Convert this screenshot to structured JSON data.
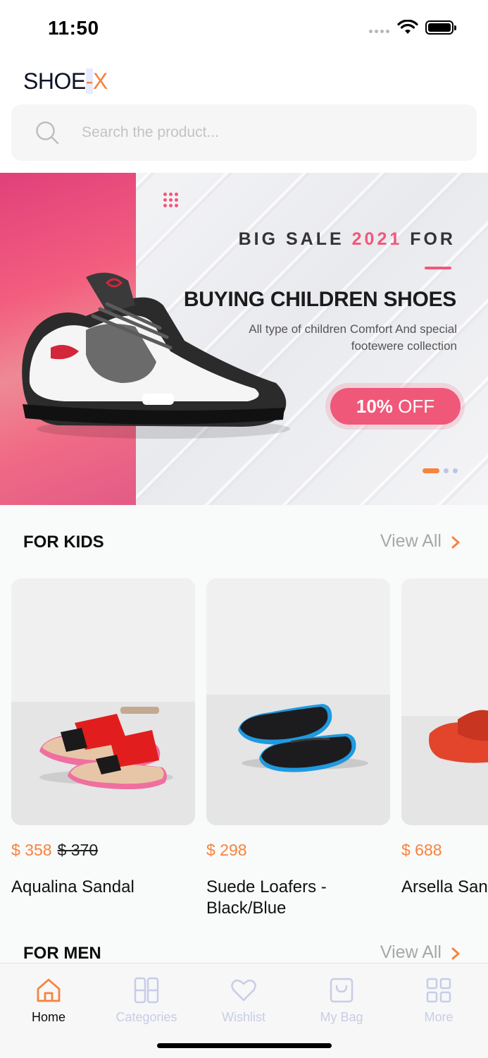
{
  "status_bar": {
    "time": "11:50"
  },
  "header": {
    "logo_part1": "SHOE",
    "logo_dash": "-",
    "logo_part2": "X",
    "search_placeholder": "Search the product..."
  },
  "banner": {
    "kicker_pre": "BIG SALE",
    "kicker_year": "2021",
    "kicker_post": "FOR",
    "title": "BUYING CHILDREN SHOES",
    "description": "All type of children Comfort And special footewere collection",
    "offer_percent": "10%",
    "offer_text": "OFF",
    "slides": 3,
    "active_slide": 1,
    "colors": {
      "pink": "#f0587a",
      "accent": "#f7833e"
    }
  },
  "sections": {
    "kids": {
      "title": "FOR KIDS",
      "view_all": "View All"
    },
    "men": {
      "title": "FOR MEN",
      "view_all": "View All"
    }
  },
  "products": [
    {
      "price": "$ 358",
      "old_price": "$ 370",
      "name": "Aqualina Sandal"
    },
    {
      "price": "$ 298",
      "name": "Suede Loafers -\nBlack/Blue"
    },
    {
      "price": "$ 688",
      "name": "Arsella Sandal"
    }
  ],
  "tabbar": {
    "items": [
      {
        "label": "Home",
        "icon": "home-icon",
        "active": true
      },
      {
        "label": "Categories",
        "icon": "categories-icon",
        "active": false
      },
      {
        "label": "Wishlist",
        "icon": "heart-icon",
        "active": false
      },
      {
        "label": "My Bag",
        "icon": "bag-icon",
        "active": false
      },
      {
        "label": "More",
        "icon": "grid-icon",
        "active": false
      }
    ],
    "active_color": "#f7833e",
    "inactive_color": "#c7cde6"
  }
}
